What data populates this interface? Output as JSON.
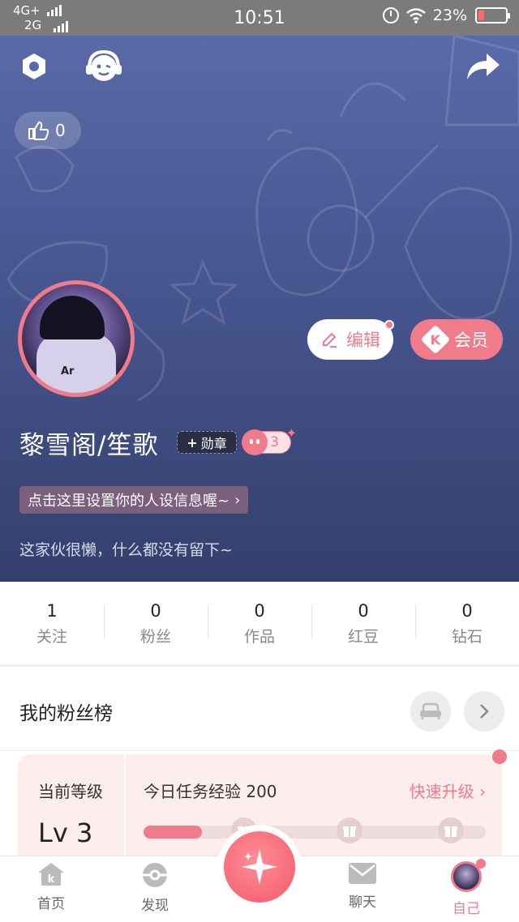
{
  "status_bar": {
    "network_top": "4G+",
    "network_bottom": "2G",
    "time": "10:51",
    "battery": "23%"
  },
  "header": {
    "settings_icon": "hexagon-settings-icon",
    "service_icon": "headset-face-icon",
    "share_icon": "share-arrow-icon",
    "like_count": "0",
    "edit_label": "编辑",
    "vip_label": "会员",
    "vip_badge_letter": "K",
    "username": "黎雪阁/笙歌",
    "medal_label": "勋章",
    "medal_plus": "+",
    "level_badge_value": "3",
    "persona_prompt": "点击这里设置你的人设信息喔~",
    "bio": "这家伙很懒，什么都没有留下~"
  },
  "stats": [
    {
      "value": "1",
      "label": "关注"
    },
    {
      "value": "0",
      "label": "粉丝"
    },
    {
      "value": "0",
      "label": "作品"
    },
    {
      "value": "0",
      "label": "红豆"
    },
    {
      "value": "0",
      "label": "钻石"
    }
  ],
  "fans": {
    "title": "我的粉丝榜"
  },
  "level": {
    "current_label": "当前等级",
    "current_value": "Lv 3",
    "task_label": "今日任务经验 200",
    "upgrade_label": "快速升级",
    "progress": 0.17
  },
  "tabbar": {
    "items": [
      {
        "label": "首页",
        "icon": "home-k-icon"
      },
      {
        "label": "发现",
        "icon": "discover-ball-icon"
      },
      {
        "label": "聊天",
        "icon": "mail-icon"
      },
      {
        "label": "自己",
        "icon": "avatar-icon"
      }
    ],
    "center_icon": "sparkle-gem-icon"
  },
  "colors": {
    "accent": "#f07b8a",
    "header_top": "#5a6aa8",
    "header_bottom": "#343f6c"
  }
}
